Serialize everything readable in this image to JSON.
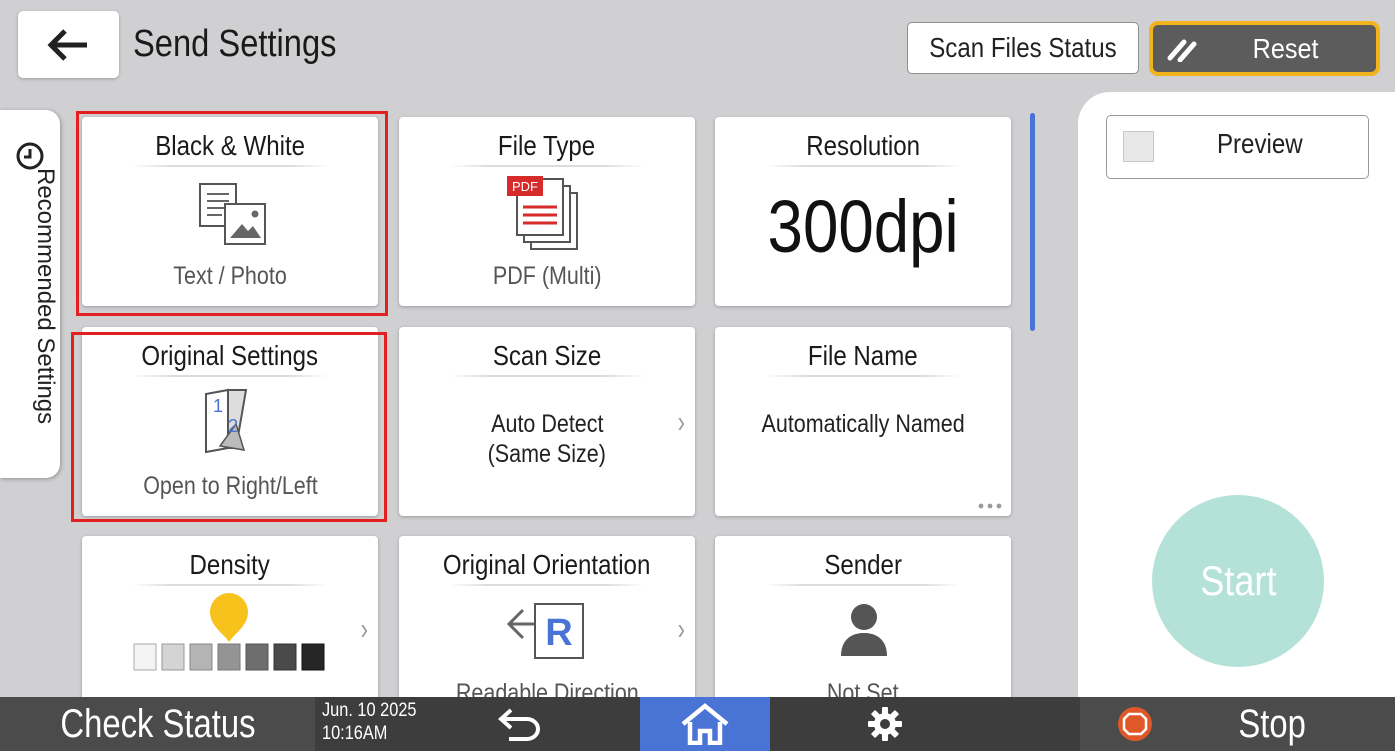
{
  "header": {
    "title": "Send Settings",
    "scan_files_status": "Scan Files Status",
    "reset": "Reset"
  },
  "side_tab": {
    "label": "Recommended Settings",
    "icon": "clock-icon"
  },
  "tiles": [
    {
      "title": "Black & White",
      "value": "Text / Photo",
      "icon": "text-photo-icon",
      "highlighted": true
    },
    {
      "title": "File Type",
      "value": "PDF (Multi)",
      "icon": "pdf-multi-icon",
      "badge": "PDF"
    },
    {
      "title": "Resolution",
      "value": "300dpi"
    },
    {
      "title": "Original Settings",
      "value": "Open to Right/Left",
      "icon": "page-flip-icon",
      "highlighted": true
    },
    {
      "title": "Scan Size",
      "value_line1": "Auto Detect",
      "value_line2": "(Same Size)"
    },
    {
      "title": "File Name",
      "value": "Automatically Named"
    },
    {
      "title": "Density",
      "icon": "density-scale-icon",
      "level": 4,
      "levels": 7
    },
    {
      "title": "Original Orientation",
      "value": "Readable Direction",
      "icon": "readable-direction-icon"
    },
    {
      "title": "Sender",
      "value": "Not Set",
      "icon": "person-icon"
    }
  ],
  "right_panel": {
    "preview": "Preview",
    "start": "Start"
  },
  "bottom_bar": {
    "check_status": "Check Status",
    "date": "Jun. 10 2025",
    "time": "10:16AM",
    "stop": "Stop"
  },
  "colors": {
    "accent_blue": "#4a73d6",
    "reset_border": "#f2b31c",
    "highlight_red": "#e12020",
    "start_green": "#b5e2d8",
    "pdf_red": "#d62b2b"
  }
}
